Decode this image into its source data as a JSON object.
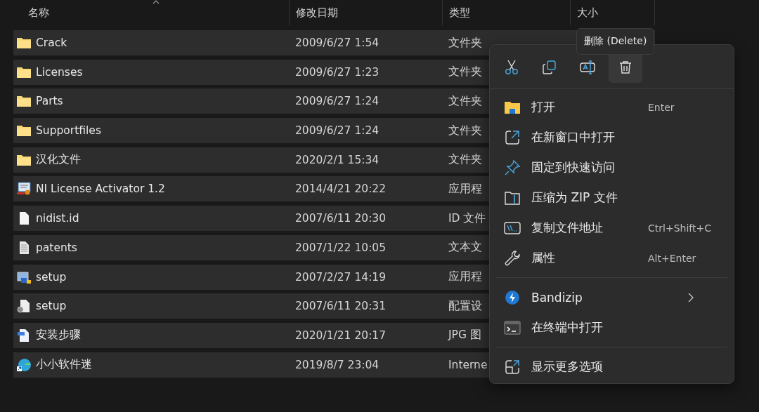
{
  "columns": [
    {
      "label": "名称",
      "sorted": true
    },
    {
      "label": "修改日期",
      "sorted": false
    },
    {
      "label": "类型",
      "sorted": false
    },
    {
      "label": "大小",
      "sorted": false
    }
  ],
  "rows": [
    {
      "kind": "folder",
      "name": "Crack",
      "date": "2009/6/27 1:54",
      "type": "文件夹",
      "selected": true
    },
    {
      "kind": "folder",
      "name": "Licenses",
      "date": "2009/6/27 1:23",
      "type": "文件夹",
      "selected": true
    },
    {
      "kind": "folder",
      "name": "Parts",
      "date": "2009/6/27 1:24",
      "type": "文件夹",
      "selected": true
    },
    {
      "kind": "folder",
      "name": "Supportfiles",
      "date": "2009/6/27 1:24",
      "type": "文件夹",
      "selected": true
    },
    {
      "kind": "folder",
      "name": "汉化文件",
      "date": "2020/2/1 15:34",
      "type": "文件夹",
      "selected": true
    },
    {
      "kind": "certificate",
      "name": "NI License Activator 1.2",
      "date": "2014/4/21 20:22",
      "type": "应用程",
      "selected": true
    },
    {
      "kind": "file",
      "name": "nidist.id",
      "date": "2007/6/11 20:30",
      "type": "ID 文件",
      "selected": true
    },
    {
      "kind": "text",
      "name": "patents",
      "date": "2007/1/22 10:05",
      "type": "文本文",
      "selected": true
    },
    {
      "kind": "installer",
      "name": "setup",
      "date": "2007/2/27 14:19",
      "type": "应用程",
      "selected": true
    },
    {
      "kind": "config",
      "name": "setup",
      "date": "2007/6/11 20:31",
      "type": "配置设",
      "selected": true
    },
    {
      "kind": "image",
      "name": "安装步骤",
      "date": "2020/1/21 20:17",
      "type": "JPG 图",
      "selected": true
    },
    {
      "kind": "shortcut",
      "name": "小小软件迷",
      "date": "2019/8/7 23:04",
      "type": "Interne",
      "selected": true
    }
  ],
  "context_menu": {
    "toolbar": [
      {
        "kind": "cut",
        "highlighted": false
      },
      {
        "kind": "copy",
        "highlighted": false
      },
      {
        "kind": "rename",
        "highlighted": false
      },
      {
        "kind": "delete",
        "highlighted": true
      }
    ],
    "tooltip": "删除 (Delete)",
    "sections": [
      {
        "items": [
          {
            "kind": "open",
            "label": "打开",
            "shortcut": "Enter",
            "submenu": false
          },
          {
            "kind": "new-window",
            "label": "在新窗口中打开",
            "submenu": false
          },
          {
            "kind": "pin",
            "label": "固定到快速访问",
            "submenu": false
          },
          {
            "kind": "zip",
            "label": "压缩为 ZIP 文件",
            "submenu": false
          },
          {
            "kind": "path",
            "label": "复制文件地址",
            "shortcut": "Ctrl+Shift+C",
            "submenu": false
          },
          {
            "kind": "properties",
            "label": "属性",
            "shortcut": "Alt+Enter",
            "submenu": false
          }
        ]
      },
      {
        "items": [
          {
            "kind": "bandizip",
            "label": "Bandizip",
            "submenu": true
          },
          {
            "kind": "terminal",
            "label": "在终端中打开",
            "submenu": false
          }
        ]
      },
      {
        "items": [
          {
            "kind": "more",
            "label": "显示更多选项",
            "submenu": false
          }
        ]
      }
    ]
  }
}
